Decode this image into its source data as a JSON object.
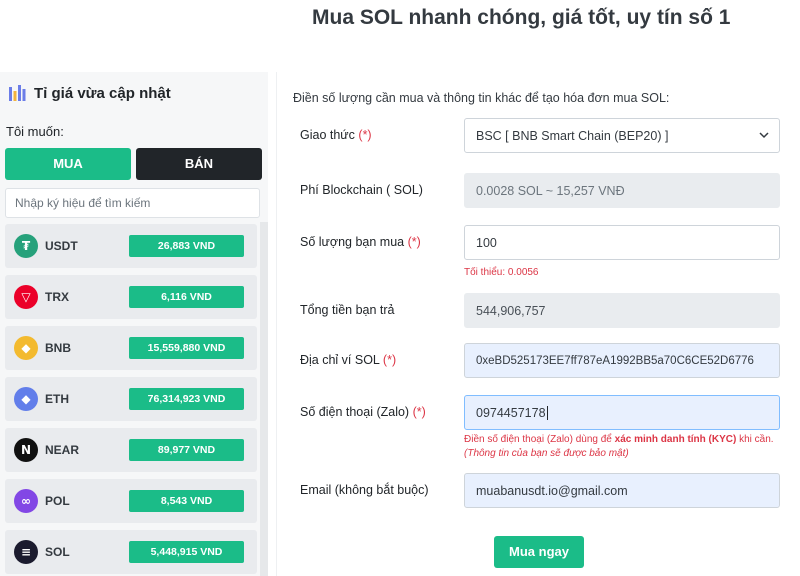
{
  "page": {
    "title": "Mua SOL nhanh chóng, giá tốt, uy tín số 1"
  },
  "rates": {
    "title": "Tỉ giá vừa cập nhật",
    "want_label": "Tôi muốn:",
    "buy_label": "MUA",
    "sell_label": "BÁN",
    "search_placeholder": "Nhập ký hiệu để tìm kiếm",
    "coins": [
      {
        "symbol": "USDT",
        "price": "26,883 VND",
        "icon": "tether-icon",
        "color": "#26a17b",
        "glyph": "₮"
      },
      {
        "symbol": "TRX",
        "price": "6,116 VND",
        "icon": "tron-icon",
        "color": "#eb0029",
        "glyph": "▽"
      },
      {
        "symbol": "BNB",
        "price": "15,559,880 VND",
        "icon": "bnb-icon",
        "color": "#f3ba2f",
        "glyph": "◆"
      },
      {
        "symbol": "ETH",
        "price": "76,314,923 VND",
        "icon": "ethereum-icon",
        "color": "#627eea",
        "glyph": "◆"
      },
      {
        "symbol": "NEAR",
        "price": "89,977 VND",
        "icon": "near-icon",
        "color": "#111111",
        "glyph": "N"
      },
      {
        "symbol": "POL",
        "price": "8,543 VND",
        "icon": "polygon-icon",
        "color": "#8247e5",
        "glyph": "∞"
      },
      {
        "symbol": "SOL",
        "price": "5,448,915 VND",
        "icon": "solana-icon",
        "color": "#1b1b2e",
        "glyph": "≡"
      }
    ]
  },
  "form": {
    "intro": "Điền số lượng cần mua và thông tin khác để tạo hóa đơn mua SOL:",
    "protocol_label": "Giao thức",
    "protocol_value": "BSC [ BNB Smart Chain (BEP20) ]",
    "fee_label": "Phí Blockchain ( SOL)",
    "fee_value": "0.0028 SOL ~ 15,257 VNĐ",
    "amount_label": "Số lượng bạn mua",
    "amount_value": "100",
    "amount_hint": "Tối thiểu: 0.0056",
    "total_label": "Tổng tiền bạn trả",
    "total_value": "544,906,757",
    "wallet_label": "Địa chỉ ví SOL",
    "wallet_value": "0xeBD525173EE7ff787eA1992BB5a70C6CE52D6776",
    "phone_label": "Số điện thoại (Zalo)",
    "phone_value": "0974457178",
    "phone_hint_pre": "Điền số điện thoại (Zalo) dùng để ",
    "phone_hint_bold": "xác minh danh tính (KYC)",
    "phone_hint_post": " khi cần.",
    "phone_hint_note": "(Thông tin của bạn sẽ được bảo mật)",
    "email_label": "Email (không bắt buộc)",
    "email_value": "muabanusdt.io@gmail.com",
    "required_mark": "(*)",
    "submit_label": "Mua ngay"
  },
  "colors": {
    "accent": "#1bbc88",
    "dark": "#212529",
    "required": "#dc3545"
  }
}
